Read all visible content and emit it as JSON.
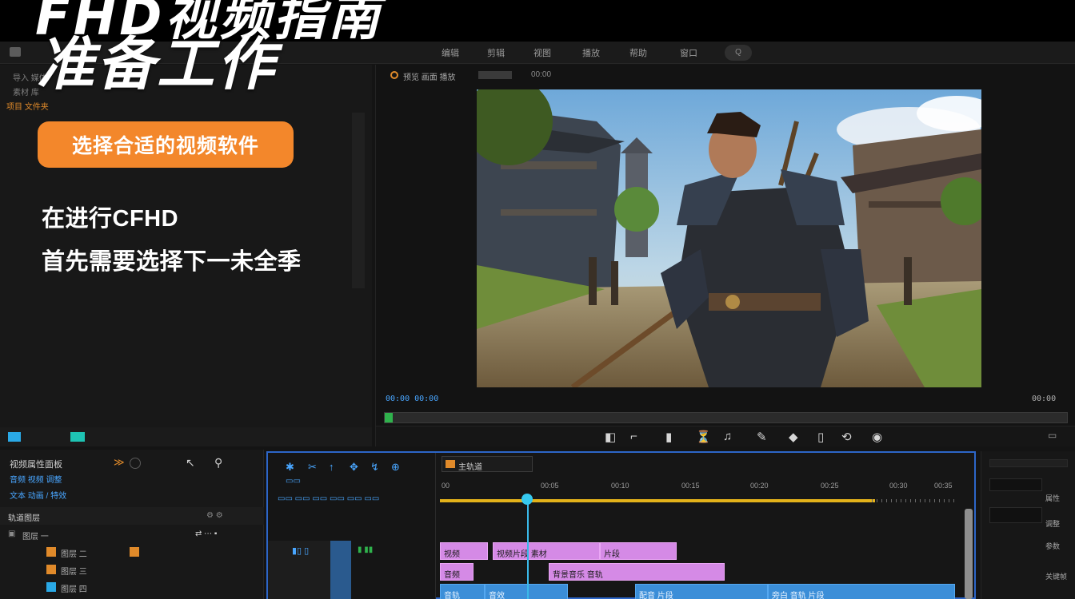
{
  "banner": {
    "title": "FHD视频指南",
    "subtitle": "准备工作",
    "pill_label": "选择合适的视频软件",
    "body_lines": [
      "在进行CFHD",
      "首先需要选择下一未全季"
    ]
  },
  "menubar": {
    "items": [
      "编辑",
      "剪辑",
      "视图",
      "播放",
      "帮助",
      "窗口"
    ],
    "search_label": "Q"
  },
  "left_panel": {
    "rows": [
      "导入 媒体",
      "素材 库",
      "项目 文件夹"
    ]
  },
  "preview": {
    "header_label": "预览 画面 播放",
    "header_value": "00:00",
    "timecode_left": "00:00  00:00",
    "timecode_right": "00:00",
    "tool_icons": [
      "split-icon",
      "crop-icon",
      "mask-icon",
      "speed-icon",
      "audio-icon",
      "color-icon",
      "text-icon",
      "effect-icon",
      "settings-icon"
    ]
  },
  "inspector": {
    "title": "视频属性面板",
    "subtitle_1": "音频 视频 调整",
    "subtitle_2": "文本 动画 / 特效",
    "section_label": "轨道图层",
    "layers": [
      "图层 一",
      "图层 二",
      "图层 三",
      "图层 四"
    ]
  },
  "timeline": {
    "track_name": "主轨道",
    "ruler_labels": [
      "00",
      "00:05",
      "00:10",
      "00:15",
      "00:20",
      "00:25",
      "00:30",
      "00:35"
    ],
    "clips_row1": [
      "视频",
      "视频片段 素材",
      "片段"
    ],
    "clips_row2": [
      "音频",
      "背景音乐 音轨"
    ],
    "clips_row3": [
      "音轨",
      "音效",
      "配音 片段",
      "旁白 音轨 片段"
    ],
    "progress_fraction": 0.84
  },
  "right_panel": {
    "labels": [
      "属性",
      "调整",
      "参数",
      "关键帧"
    ]
  },
  "colors": {
    "accent_orange": "#f3872b",
    "timeline_border": "#2d66c8",
    "playhead": "#36c9ef",
    "ruler_yellow": "#e3b21a",
    "clip_pink": "#d58ae6",
    "clip_blue": "#3b8ed8"
  }
}
